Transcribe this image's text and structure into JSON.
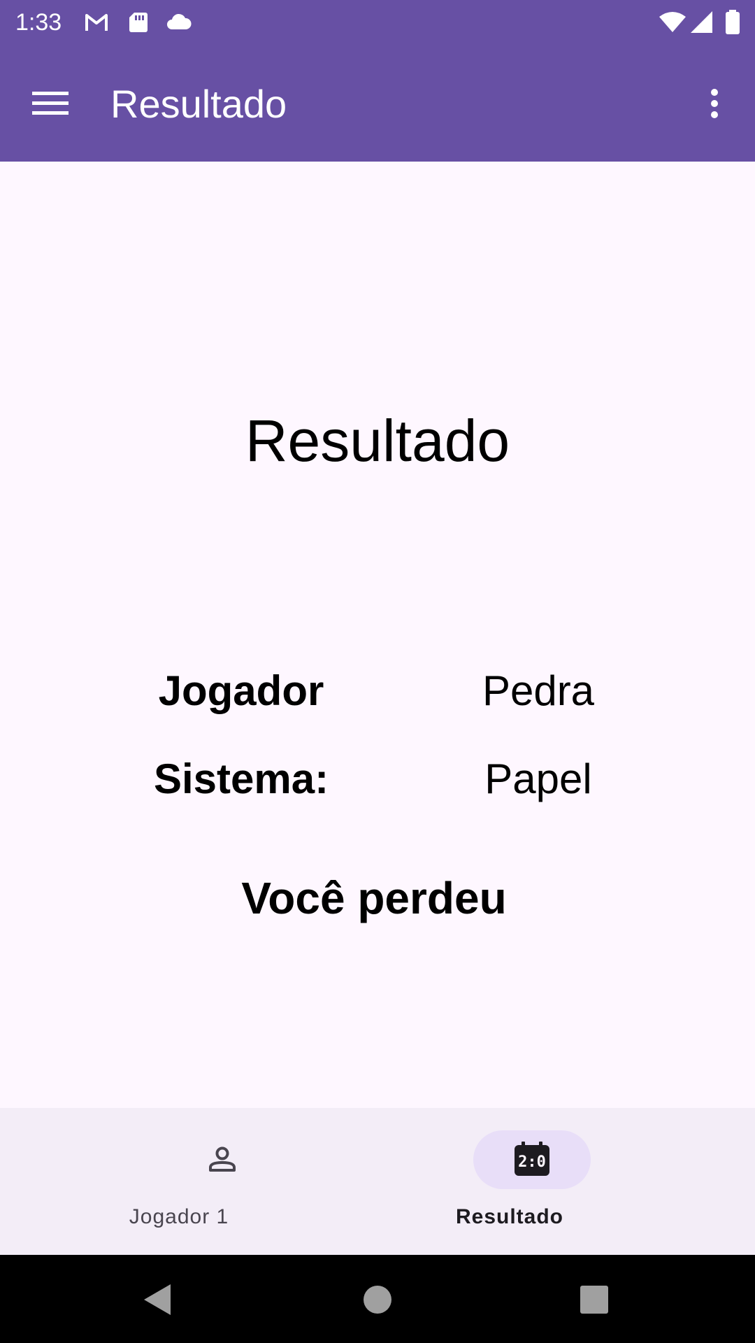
{
  "status_bar": {
    "time": "1:33",
    "icons": [
      "gmail-icon",
      "sd-card-icon",
      "cloud-icon",
      "wifi-icon",
      "signal-icon",
      "battery-icon"
    ]
  },
  "app_bar": {
    "title": "Resultado",
    "menu_icon": "menu-icon",
    "more_icon": "more-vert-icon",
    "background_color": "#6750A4"
  },
  "content": {
    "heading": "Resultado",
    "rows": [
      {
        "label": "Jogador",
        "value": "Pedra"
      },
      {
        "label": "Sistema:",
        "value": "Papel"
      }
    ],
    "result": "Você perdeu"
  },
  "bottom_nav": {
    "items": [
      {
        "label": "Jogador 1",
        "icon": "person-icon",
        "selected": false
      },
      {
        "label": "Resultado",
        "icon": "scoreboard-icon",
        "selected": true
      }
    ],
    "indicator_color": "#E8DEF8",
    "background_color": "#F3EDF7"
  },
  "system_nav": {
    "buttons": [
      "back-icon",
      "home-icon",
      "recents-icon"
    ]
  }
}
